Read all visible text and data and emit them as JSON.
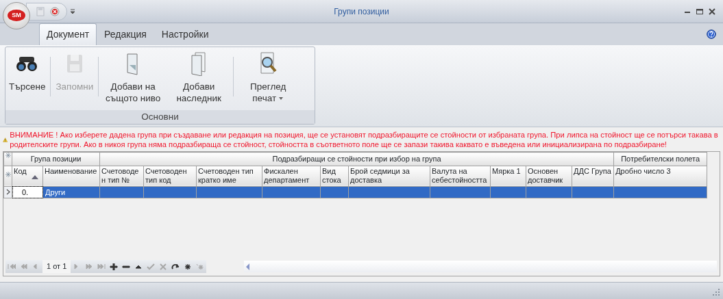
{
  "window": {
    "logo": "SM",
    "title": "Групи позиции"
  },
  "tabs": [
    {
      "label": "Документ",
      "selected": true
    },
    {
      "label": "Редакция",
      "selected": false
    },
    {
      "label": "Настройки",
      "selected": false
    }
  ],
  "ribbon": {
    "groups": [
      {
        "label": "Основни",
        "items": [
          {
            "kind": "button",
            "label": "Търсене",
            "disabled": false,
            "dropdown": false
          },
          {
            "kind": "separator"
          },
          {
            "kind": "button",
            "label": "Запомни",
            "disabled": true,
            "dropdown": false
          },
          {
            "kind": "separator"
          },
          {
            "kind": "button",
            "label": "Добави на същото ниво",
            "disabled": false,
            "dropdown": false
          },
          {
            "kind": "button",
            "label": "Добави наследник",
            "disabled": false,
            "dropdown": false
          },
          {
            "kind": "separator"
          },
          {
            "kind": "button",
            "label": "Преглед печат",
            "disabled": false,
            "dropdown": true
          }
        ]
      }
    ]
  },
  "warning": {
    "text": "ВНИМАНИЕ ! Ако изберете дадена група при създаване или редакция на позиция, ще се установят подразбиращите се стойности от избраната група. При липса на стойност ще се потърси такава в родителските групи. Ако в никоя група няма подразбираща се стойност, стойността в съответното поле ще се запази такива каквато е въведена или инициализирана по подразбиране!"
  },
  "grid": {
    "bands": [
      {
        "label": "Група позиции",
        "columns": [
          {
            "label": "Код",
            "sorted": true
          },
          {
            "label": "Наименование",
            "sorted": false
          }
        ]
      },
      {
        "label": "Подразбиращи се стойности при избор на група",
        "columns": [
          {
            "label": "Счетоводе н тип №",
            "sorted": false
          },
          {
            "label": "Счетоводен тип код",
            "sorted": false
          },
          {
            "label": "Счетоводен тип кратко име",
            "sorted": false
          },
          {
            "label": "Фискален департамент",
            "sorted": false
          },
          {
            "label": "Вид стока",
            "sorted": false
          },
          {
            "label": "Брой седмици за доставка",
            "sorted": false
          },
          {
            "label": "Валута на себестойността",
            "sorted": false
          },
          {
            "label": "Мярка 1",
            "sorted": false
          },
          {
            "label": "Основен доставчик",
            "sorted": false
          },
          {
            "label": "ДДС Група",
            "sorted": false
          }
        ]
      },
      {
        "label": "Потребителски полета",
        "columns": [
          {
            "label": "Дробно число 3",
            "sorted": false
          }
        ]
      }
    ],
    "rows": [
      {
        "selected": true,
        "cells": [
          "0.",
          "Други"
        ]
      }
    ],
    "navigator": {
      "page": "1 от 1",
      "buttons": [
        {
          "kind": "first",
          "disabled": true
        },
        {
          "kind": "prev-page",
          "disabled": true
        },
        {
          "kind": "prev",
          "disabled": true
        },
        {
          "kind": "page"
        },
        {
          "kind": "next",
          "disabled": true
        },
        {
          "kind": "next-page",
          "disabled": true
        },
        {
          "kind": "last",
          "disabled": true
        },
        {
          "kind": "add",
          "disabled": false
        },
        {
          "kind": "remove",
          "disabled": false
        },
        {
          "kind": "edit",
          "disabled": false
        },
        {
          "kind": "accept",
          "disabled": true
        },
        {
          "kind": "cancel",
          "disabled": true
        },
        {
          "kind": "refresh",
          "disabled": false
        },
        {
          "kind": "filter",
          "disabled": false
        },
        {
          "kind": "filter-clear",
          "disabled": true
        }
      ]
    }
  }
}
